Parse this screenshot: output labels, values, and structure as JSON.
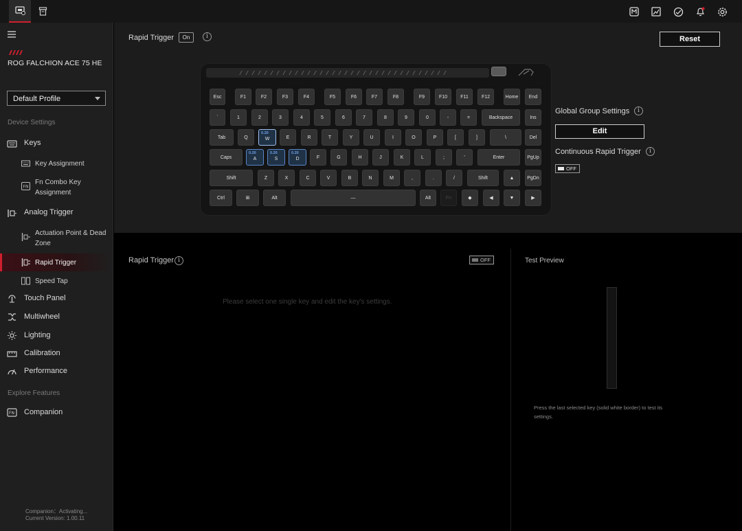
{
  "topbar": {
    "tabs": [
      {
        "icon": "device-icon",
        "active": true
      },
      {
        "icon": "store-icon",
        "active": false
      }
    ],
    "actions": [
      "macro-icon",
      "image-icon",
      "sync-icon",
      "bell-icon",
      "gear-icon"
    ]
  },
  "sidebar": {
    "device_name": "ROG FALCHION ACE 75 HE",
    "profile": "Default Profile",
    "device_settings_label": "Device Settings",
    "keys_label": "Keys",
    "key_assignment": "Key Assignment",
    "fn_combo_key": "Fn Combo Key Assignment",
    "analog_trigger": "Analog Trigger",
    "actuation_point": "Actuation Point & Dead Zone",
    "rapid_trigger": "Rapid Trigger",
    "speed_tap": "Speed Tap",
    "touch_panel": "Touch Panel",
    "multiwheel": "Multiwheel",
    "lighting": "Lighting",
    "calibration": "Calibration",
    "performance": "Performance",
    "explore_label": "Explore Features",
    "companion": "Companion",
    "footer_status": "Companion：Activating...",
    "footer_version": "Current Version: 1.00.11"
  },
  "main": {
    "rapid_trigger_title": "Rapid Trigger",
    "rapid_trigger_state": "On",
    "reset_label": "Reset",
    "global_group_label": "Global Group Settings",
    "edit_label": "Edit",
    "continuous_rt_label": "Continuous Rapid Trigger",
    "continuous_rt_state": "OFF"
  },
  "keyboard": {
    "rows": [
      [
        "Esc",
        "F1",
        "F2",
        "F3",
        "F4",
        "F5",
        "F6",
        "F7",
        "F8",
        "F9",
        "F10",
        "F11",
        "F12",
        "Home",
        "End"
      ],
      [
        "`",
        "1",
        "2",
        "3",
        "4",
        "5",
        "6",
        "7",
        "8",
        "9",
        "0",
        "-",
        "=",
        "Backspace",
        "Ins"
      ],
      [
        "Tab",
        "Q",
        "W",
        "E",
        "R",
        "T",
        "Y",
        "U",
        "I",
        "O",
        "P",
        "[",
        "]",
        "\\",
        "Del"
      ],
      [
        "Caps",
        "A",
        "S",
        "D",
        "F",
        "G",
        "H",
        "J",
        "K",
        "L",
        ";",
        "'",
        "Enter",
        "PgUp"
      ],
      [
        "Shift",
        "Z",
        "X",
        "C",
        "V",
        "B",
        "N",
        "M",
        ",",
        ".",
        "/",
        "Shift",
        "▲",
        "PgDn"
      ],
      [
        "Ctrl",
        "⊞",
        "Alt",
        "—",
        "Alt",
        "Fn",
        "◆",
        "◀",
        "▼",
        "▶"
      ]
    ],
    "highlight_value": "0.20",
    "highlighted_keys": [
      "W",
      "A",
      "S",
      "D"
    ]
  },
  "bottom": {
    "rapid_trigger_title": "Rapid Trigger",
    "rapid_trigger_state": "OFF",
    "hint": "Please select one single key and edit the key's settings.",
    "test_preview_title": "Test Preview",
    "test_preview_note": "Press the last selected key (solid white border) to test its settings."
  }
}
